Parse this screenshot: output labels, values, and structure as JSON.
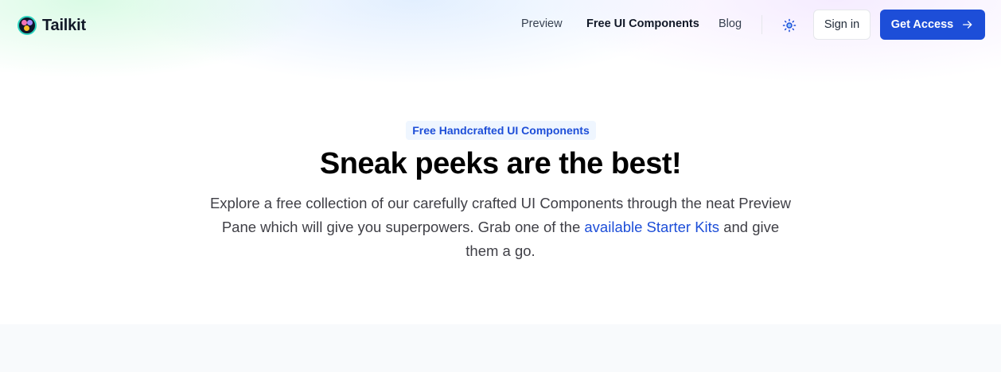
{
  "brand": {
    "name": "Tailkit",
    "logo_icon": "tailkit-logo-icon"
  },
  "nav": {
    "items": [
      {
        "label": "Preview"
      },
      {
        "label": "Free UI Components"
      },
      {
        "label": "Blog"
      }
    ],
    "theme_toggle_icon": "sun-icon",
    "signin_label": "Sign in",
    "cta_label": "Get Access",
    "cta_icon": "arrow-right-icon"
  },
  "hero": {
    "badge": "Free Handcrafted UI Components",
    "title": "Sneak peeks are the best!",
    "description_before": "Explore a free collection of our carefully crafted UI Components through the neat Preview Pane which will give you superpowers. Grab one of the ",
    "description_link": "available Starter Kits",
    "description_after": " and give them a go."
  },
  "colors": {
    "accent": "#1d4ed8",
    "badge_bg": "#eff6ff",
    "panel_bg": "#f8fafc"
  }
}
